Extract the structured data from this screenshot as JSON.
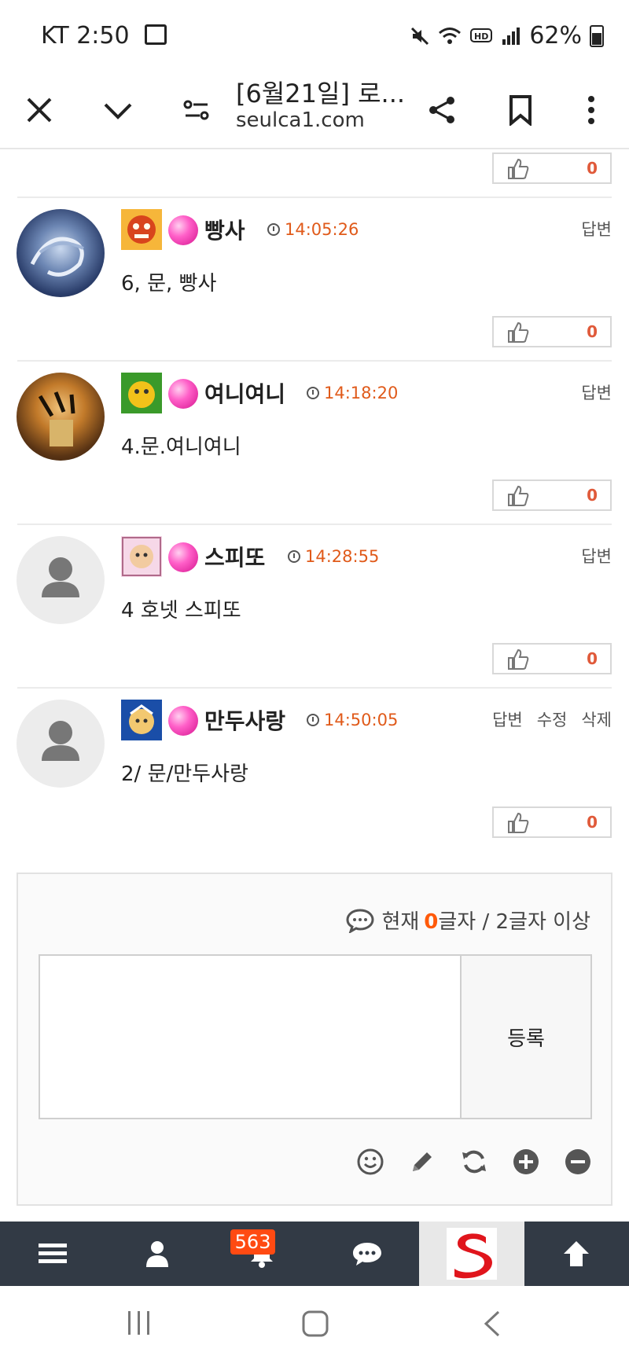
{
  "status_bar": {
    "carrier_time": "KT 2:50",
    "battery": "62%"
  },
  "browser": {
    "title": "[6월21일] 로...",
    "domain": "seulca1.com"
  },
  "top_like_count": "0",
  "comments": [
    {
      "nickname": "빵사",
      "time": "14:05:26",
      "text": "6, 문, 빵사",
      "likes": "0",
      "actions": [
        "답변"
      ]
    },
    {
      "nickname": "여니여니",
      "time": "14:18:20",
      "text": "4.문.여니여니",
      "likes": "0",
      "actions": [
        "답변"
      ]
    },
    {
      "nickname": "스피또",
      "time": "14:28:55",
      "text": "4 호넷 스피또",
      "likes": "0",
      "actions": [
        "답변"
      ]
    },
    {
      "nickname": "만두사랑",
      "time": "14:50:05",
      "text": "2/ 문/만두사랑",
      "likes": "0",
      "actions": [
        "답변",
        "수정",
        "삭제"
      ]
    }
  ],
  "write": {
    "count_prefix": "현재",
    "count_value": "0",
    "count_suffix": "글자 / 2글자 이상",
    "submit_label": "등록"
  },
  "bottom_nav": {
    "notification_badge": "563"
  },
  "colors": {
    "accent": "#e05a1a",
    "nav_bg": "#323a45",
    "badge": "#ff4a12"
  }
}
